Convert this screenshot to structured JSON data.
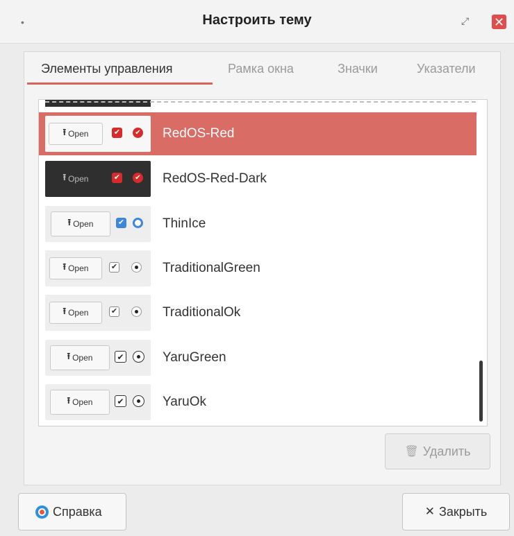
{
  "window": {
    "title": "Настроить тему",
    "close_glyph": "✕",
    "restore_glyph": "⤢",
    "menu_glyph": "•"
  },
  "tabs": [
    {
      "label": "Элементы управления",
      "active": true
    },
    {
      "label": "Рамка окна",
      "active": false
    },
    {
      "label": "Значки",
      "active": false
    },
    {
      "label": "Указатели",
      "active": false
    }
  ],
  "themes": {
    "open_label": "Open",
    "upload_glyph": "⭱",
    "check_glyph": "✔",
    "items": [
      {
        "name": "RedOS-Red",
        "selected": true,
        "style": "red-light"
      },
      {
        "name": "RedOS-Red-Dark",
        "selected": false,
        "style": "red-dark"
      },
      {
        "name": "ThinIce",
        "selected": false,
        "style": "thinice"
      },
      {
        "name": "TraditionalGreen",
        "selected": false,
        "style": "traditional"
      },
      {
        "name": "TraditionalOk",
        "selected": false,
        "style": "traditional"
      },
      {
        "name": "YaruGreen",
        "selected": false,
        "style": "yaru"
      },
      {
        "name": "YaruOk",
        "selected": false,
        "style": "yaru"
      }
    ]
  },
  "buttons": {
    "delete_label": "Удалить",
    "help_label": "Справка",
    "close_label": "Закрыть",
    "close_glyph": "✕",
    "trash_glyph": "🗑"
  },
  "colors": {
    "selected_row": "#da6c66",
    "tab_underline": "#d8625a",
    "close_button": "#e04c4c",
    "accent_red": "#d72b2b",
    "accent_blue": "#3d86d8"
  }
}
